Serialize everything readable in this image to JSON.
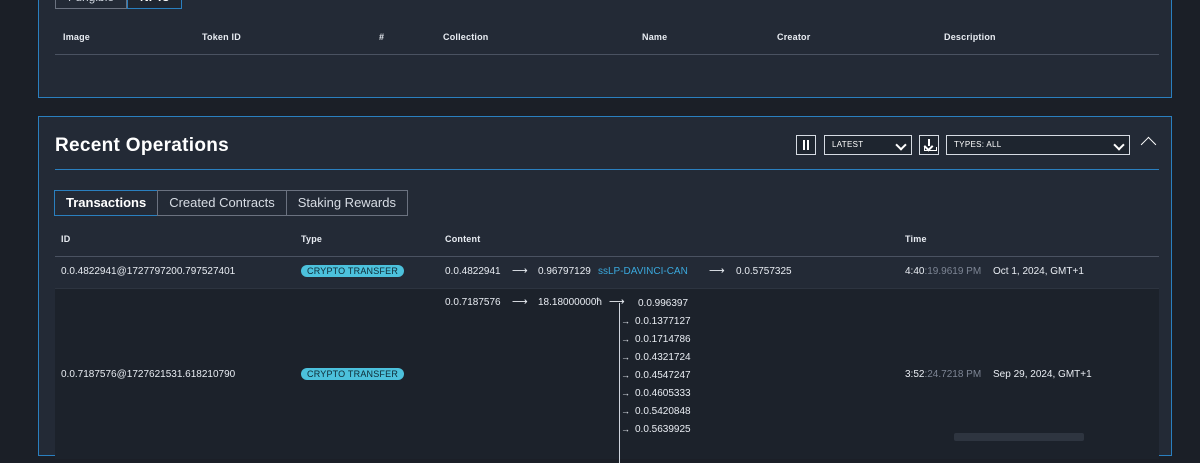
{
  "nft_panel": {
    "tabs": [
      {
        "label": "Fungible"
      },
      {
        "label": "NFTs"
      }
    ],
    "columns": [
      "Image",
      "Token ID",
      "#",
      "Collection",
      "Name",
      "Creator",
      "Description"
    ]
  },
  "ops": {
    "title": "Recent Operations",
    "latest_select": "LATEST",
    "types_select": "TYPES: ALL",
    "tabs": [
      {
        "label": "Transactions"
      },
      {
        "label": "Created Contracts"
      },
      {
        "label": "Staking Rewards"
      }
    ],
    "columns": [
      "ID",
      "Type",
      "Content",
      "Time"
    ],
    "rows": [
      {
        "id": "0.0.4822941@1727797200.797527401",
        "type": "CRYPTO TRANSFER",
        "from": "0.0.4822941",
        "amount": "0.96797129",
        "token": "ssLP-DAVINCI-CAN",
        "to": "0.0.5757325",
        "time_main": "4:40",
        "time_sub": ":19.9619 PM",
        "date": "Oct 1, 2024, GMT+1"
      },
      {
        "id": "0.0.7187576@1727621531.618210790",
        "type": "CRYPTO TRANSFER",
        "from": "0.0.7187576",
        "amount": "18.18000000ħ",
        "targets": [
          "0.0.996397",
          "0.0.1377127",
          "0.0.1714786",
          "0.0.4321724",
          "0.0.4547247",
          "0.0.4605333",
          "0.0.5420848",
          "0.0.5639925"
        ],
        "time_main": "3:52",
        "time_sub": ":24.7218 PM",
        "date": "Sep 29, 2024, GMT+1"
      }
    ]
  },
  "colors": {
    "accent": "#2a7fbf",
    "badge": "#4cc1dc",
    "link": "#3aa8dc",
    "panel": "#232a36",
    "bg": "#1b1f27"
  }
}
